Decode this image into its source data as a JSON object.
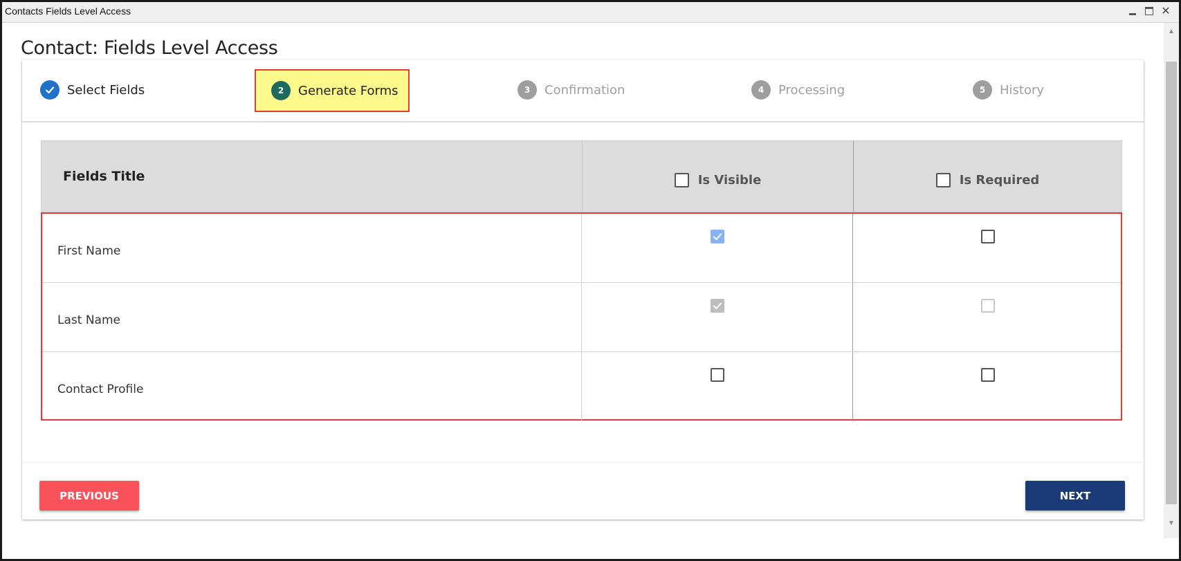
{
  "window": {
    "title": "Contacts Fields Level Access"
  },
  "page": {
    "title": "Contact: Fields Level Access"
  },
  "stepper": {
    "steps": [
      {
        "number": "1",
        "label": "Select Fields",
        "state": "done"
      },
      {
        "number": "2",
        "label": "Generate Forms",
        "state": "active"
      },
      {
        "number": "3",
        "label": "Confirmation",
        "state": "pending"
      },
      {
        "number": "4",
        "label": "Processing",
        "state": "pending"
      },
      {
        "number": "5",
        "label": "History",
        "state": "pending"
      }
    ]
  },
  "table": {
    "headers": {
      "title": "Fields Title",
      "visible": "Is Visible",
      "required": "Is Required"
    },
    "header_checkboxes": {
      "visible": false,
      "required": false
    },
    "rows": [
      {
        "title": "First Name",
        "visible": "checked",
        "required": "unchecked"
      },
      {
        "title": "Last Name",
        "visible": "checked-disabled",
        "required": "disabled"
      },
      {
        "title": "Contact Profile",
        "visible": "unchecked",
        "required": "unchecked"
      }
    ]
  },
  "buttons": {
    "previous": "PREVIOUS",
    "next": "NEXT"
  },
  "colors": {
    "done_step": "#1e73c8",
    "active_step": "#1e6b5e",
    "pending_step": "#9e9e9e",
    "highlight": "#fdf98a",
    "highlight_border": "#e53935",
    "previous_button": "#f9525a",
    "next_button": "#1b3a78"
  }
}
